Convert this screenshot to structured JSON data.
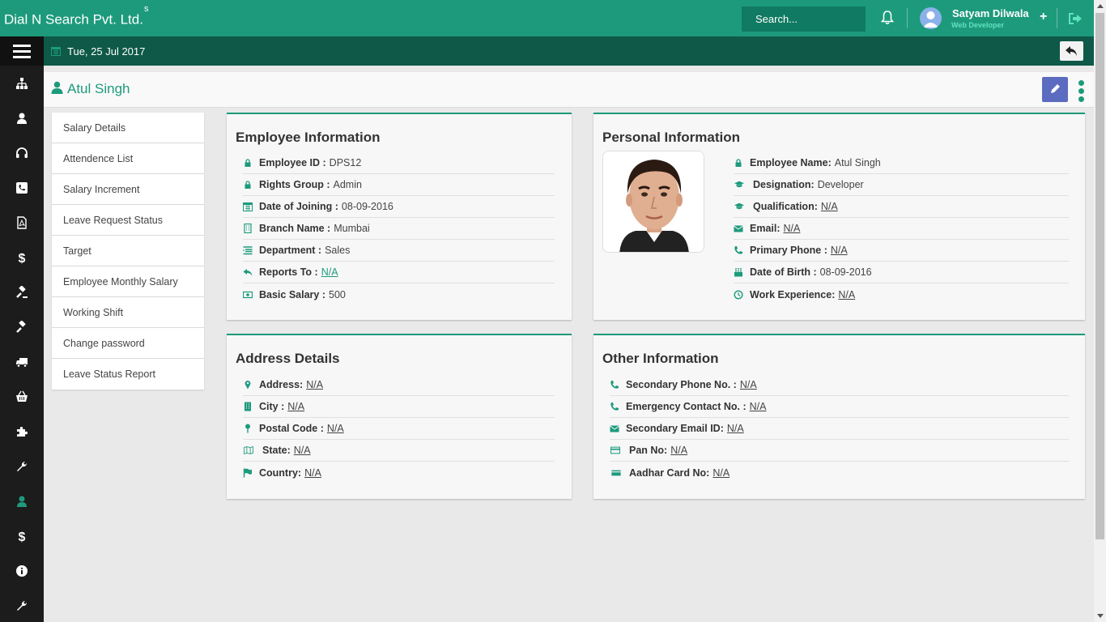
{
  "app": {
    "brand": "Dial N Search Pvt. Ltd.",
    "brand_sup": "s",
    "search_placeholder": "Search...",
    "user_name": "Satyam Dilwala",
    "user_role": "Web Developer",
    "add_label": "+"
  },
  "date_bar": {
    "date": "Tue, 25 Jul 2017"
  },
  "page": {
    "title": "Atul Singh"
  },
  "sidebar_icons": [
    "sitemap-icon",
    "user-icon",
    "headset-icon",
    "phone-icon",
    "pdf-file-icon",
    "dollar-icon",
    "gavel-icon",
    "gavel-icon",
    "truck-icon",
    "basket-icon",
    "puzzle-icon",
    "wrench-icon",
    "user-icon",
    "dollar-icon",
    "info-icon",
    "wrench-icon"
  ],
  "submenu": [
    "Salary Details",
    "Attendence List",
    "Salary Increment",
    "Leave Request Status",
    "Target",
    "Employee Monthly Salary",
    "Working Shift",
    "Change password",
    "Leave Status Report"
  ],
  "employee_info": {
    "title": "Employee Information",
    "rows": [
      {
        "label": "Employee ID :",
        "value": "DPS12",
        "icon": "lock-icon"
      },
      {
        "label": "Rights Group :",
        "value": "Admin",
        "icon": "lock-icon"
      },
      {
        "label": "Date of Joining :",
        "value": "08-09-2016",
        "icon": "calendar-icon"
      },
      {
        "label": "Branch Name :",
        "value": "Mumbai",
        "icon": "building-icon"
      },
      {
        "label": "Department :",
        "value": "Sales",
        "icon": "list-icon"
      },
      {
        "label": "Reports To :",
        "value": "N/A",
        "icon": "reply-icon"
      },
      {
        "label": "Basic Salary :",
        "value": "500",
        "icon": "money-icon"
      }
    ]
  },
  "personal_info": {
    "title": "Personal Information",
    "rows": [
      {
        "label": "Employee Name:",
        "value": "Atul Singh",
        "icon": "lock-icon"
      },
      {
        "label": "Designation:",
        "value": "Developer",
        "icon": "graduation-cap-icon"
      },
      {
        "label": "Qualification:",
        "value": "N/A",
        "icon": "graduation-cap-icon"
      },
      {
        "label": "Email:",
        "value": "N/A",
        "icon": "envelope-icon"
      },
      {
        "label": "Primary Phone :",
        "value": "N/A",
        "icon": "phone-icon"
      },
      {
        "label": "Date of Birth :",
        "value": "08-09-2016",
        "icon": "birthday-cake-icon"
      },
      {
        "label": "Work Experience:",
        "value": "N/A",
        "icon": "clock-icon"
      }
    ]
  },
  "address": {
    "title": "Address Details",
    "rows": [
      {
        "label": "Address:",
        "value": "N/A",
        "icon": "map-marker-icon"
      },
      {
        "label": "City :",
        "value": "N/A",
        "icon": "building-icon"
      },
      {
        "label": "Postal Code :",
        "value": "N/A",
        "icon": "pin-icon"
      },
      {
        "label": "State:",
        "value": "N/A",
        "icon": "map-icon"
      },
      {
        "label": "Country:",
        "value": "N/A",
        "icon": "flag-icon"
      }
    ]
  },
  "other_info": {
    "title": "Other Information",
    "rows": [
      {
        "label": "Secondary Phone No. :",
        "value": "N/A",
        "icon": "phone-icon"
      },
      {
        "label": "Emergency Contact No. :",
        "value": "N/A",
        "icon": "phone-icon"
      },
      {
        "label": "Secondary Email ID:",
        "value": "N/A",
        "icon": "envelope-icon"
      },
      {
        "label": "Pan No:",
        "value": "N/A",
        "icon": "credit-card-icon"
      },
      {
        "label": "Aadhar Card No:",
        "value": "N/A",
        "icon": "credit-card-icon"
      }
    ]
  },
  "colors": {
    "primary": "#1d9a7c",
    "dark": "#0e5947",
    "sidebar": "#1c1c1c",
    "edit_button": "#5b6bbf"
  }
}
